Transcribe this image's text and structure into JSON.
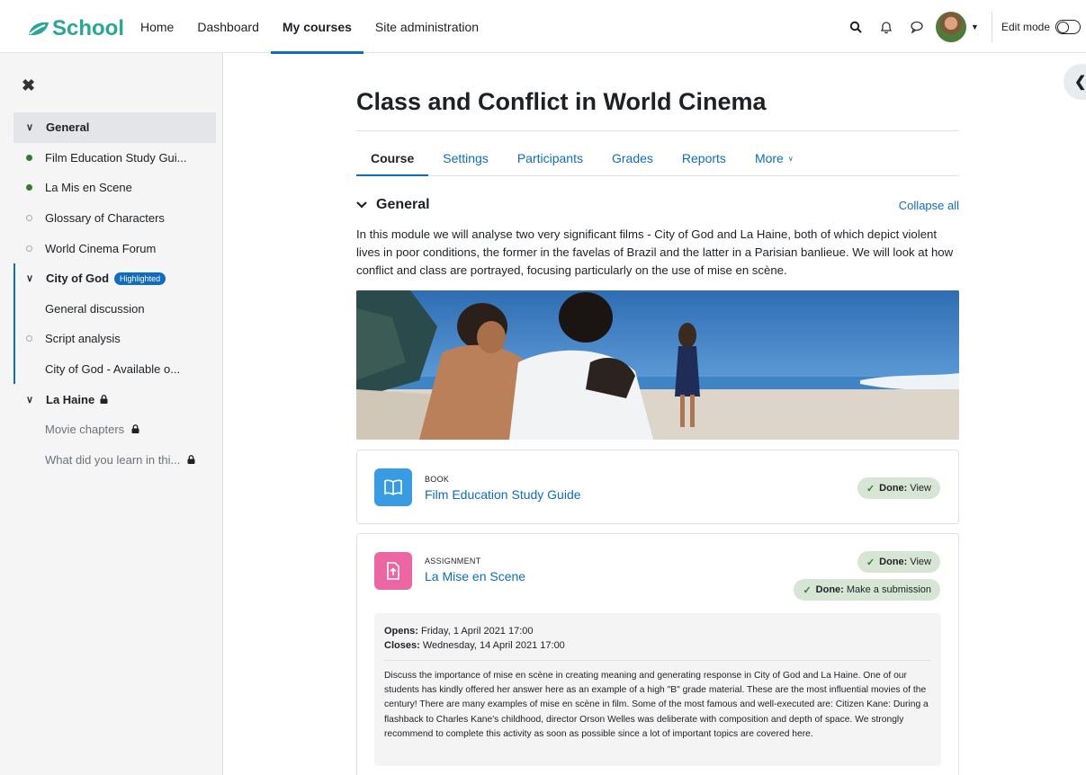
{
  "brand": {
    "name": "School",
    "color": "#2aa598"
  },
  "nav": {
    "links": [
      {
        "label": "Home"
      },
      {
        "label": "Dashboard"
      },
      {
        "label": "My courses"
      },
      {
        "label": "Site administration"
      }
    ],
    "active": "My courses",
    "icons": [
      "search-icon",
      "bell-icon",
      "chat-icon"
    ],
    "edit_mode_label": "Edit mode"
  },
  "drawer": {
    "items": [
      {
        "label": "General",
        "kind": "section"
      },
      {
        "label": "Film Education Study Gui...",
        "kind": "activity",
        "status": "done"
      },
      {
        "label": "La Mis en Scene",
        "kind": "activity",
        "status": "done"
      },
      {
        "label": "Glossary of Characters",
        "kind": "activity",
        "status": "todo"
      },
      {
        "label": "World Cinema Forum",
        "kind": "activity",
        "status": "todo"
      },
      {
        "label": "City of God",
        "kind": "section",
        "badge": "Highlighted"
      },
      {
        "label": "General discussion",
        "kind": "plain"
      },
      {
        "label": "Script analysis",
        "kind": "activity",
        "status": "todo"
      },
      {
        "label": "City of God - Available o...",
        "kind": "plain"
      },
      {
        "label": "La Haine",
        "kind": "section",
        "locked": true
      },
      {
        "label": "Movie chapters",
        "kind": "plain",
        "locked": true
      },
      {
        "label": "What did you learn in thi...",
        "kind": "plain",
        "locked": true
      }
    ]
  },
  "course": {
    "title": "Class and Conflict in World Cinema",
    "tabs": [
      {
        "label": "Course"
      },
      {
        "label": "Settings"
      },
      {
        "label": "Participants"
      },
      {
        "label": "Grades"
      },
      {
        "label": "Reports"
      },
      {
        "label": "More"
      }
    ],
    "section_title": "General",
    "collapse_label": "Collapse all",
    "summary": "In this module we will analyse two very significant films - City of God and La Haine, both of which depict violent lives in poor conditions, the former in the favelas of Brazil and the latter in a Parisian banlieue. We will look at how conflict and class are portrayed, focusing particularly on the use of mise en scène."
  },
  "activities": {
    "book": {
      "type": "BOOK",
      "name": "Film Education Study Guide",
      "done_bold": "Done:",
      "done_text": "View",
      "icon": "book-icon",
      "icon_color": "#399be2"
    },
    "assignment": {
      "type": "ASSIGNMENT",
      "name": "La Mise en Scene",
      "done1_bold": "Done:",
      "done1_text": "View",
      "done2_bold": "Done:",
      "done2_text": "Make a submission",
      "opens_label": "Opens:",
      "opens_value": "Friday, 1 April 2021 17:00",
      "closes_label": "Closes:",
      "closes_value": "Wednesday, 14 April 2021 17:00",
      "description": "Discuss the importance of  mise en scène in creating meaning and generating response in City of God and La Haine. One of our students has kindly offered her answer here as an example of a high \"B\" grade material. These are the most influential movies of the century! There are many examples of mise en scène in film. Some of the most famous and well-executed are: Citizen Kane: During a flashback to Charles Kane's childhood, director Orson Welles was deliberate with composition and depth of space. We strongly recommend to complete this activity as soon as possible since a lot of important topics are covered here.",
      "icon": "assignment-upload-icon",
      "icon_color": "#eb66a2"
    }
  }
}
